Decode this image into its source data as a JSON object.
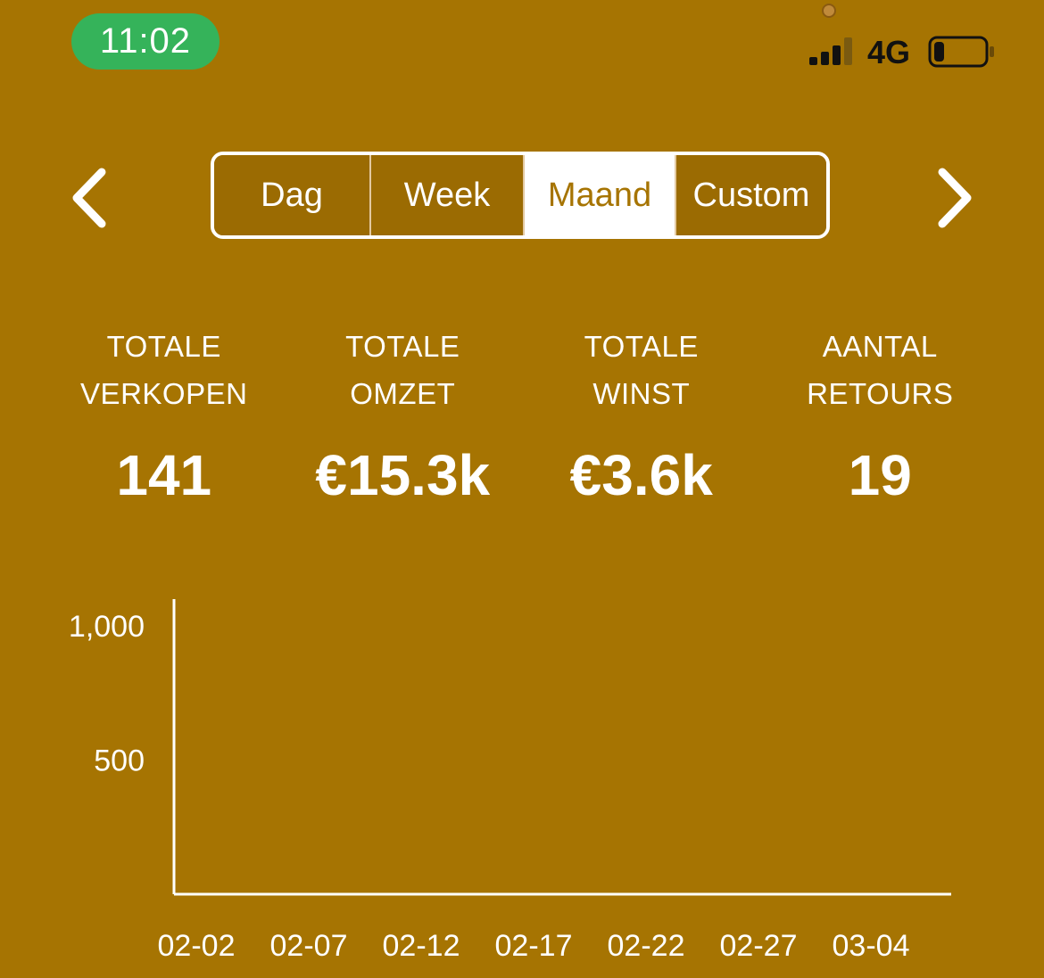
{
  "status": {
    "time": "11:02",
    "network": "4G",
    "signal_bars": 3,
    "battery_level": 0.2
  },
  "nav": {
    "prev_icon": "chevron-left-icon",
    "next_icon": "chevron-right-icon"
  },
  "period_tabs": [
    {
      "label": "Dag",
      "active": false
    },
    {
      "label": "Week",
      "active": false
    },
    {
      "label": "Maand",
      "active": true
    },
    {
      "label": "Custom",
      "active": false
    }
  ],
  "stats": [
    {
      "label": "TOTALE\nVERKOPEN",
      "value": "141"
    },
    {
      "label": "TOTALE\nOMZET",
      "value": "€15.3k"
    },
    {
      "label": "TOTALE\nWINST",
      "value": "€3.6k"
    },
    {
      "label": "AANTAL\nRETOURS",
      "value": "19"
    }
  ],
  "colors": {
    "background": "#a67402",
    "time_pill": "#35b35a",
    "active_tab_text": "#a67402"
  },
  "chart_data": {
    "type": "line",
    "title": "",
    "xlabel": "",
    "ylabel": "",
    "categories": [
      "02-02",
      "02-07",
      "02-12",
      "02-17",
      "02-22",
      "02-27",
      "03-04"
    ],
    "y_ticks": [
      {
        "value": 500,
        "label": "500"
      },
      {
        "value": 1000,
        "label": "1,000"
      }
    ],
    "ylim": [
      0,
      1100
    ],
    "series": [],
    "grid": false
  }
}
